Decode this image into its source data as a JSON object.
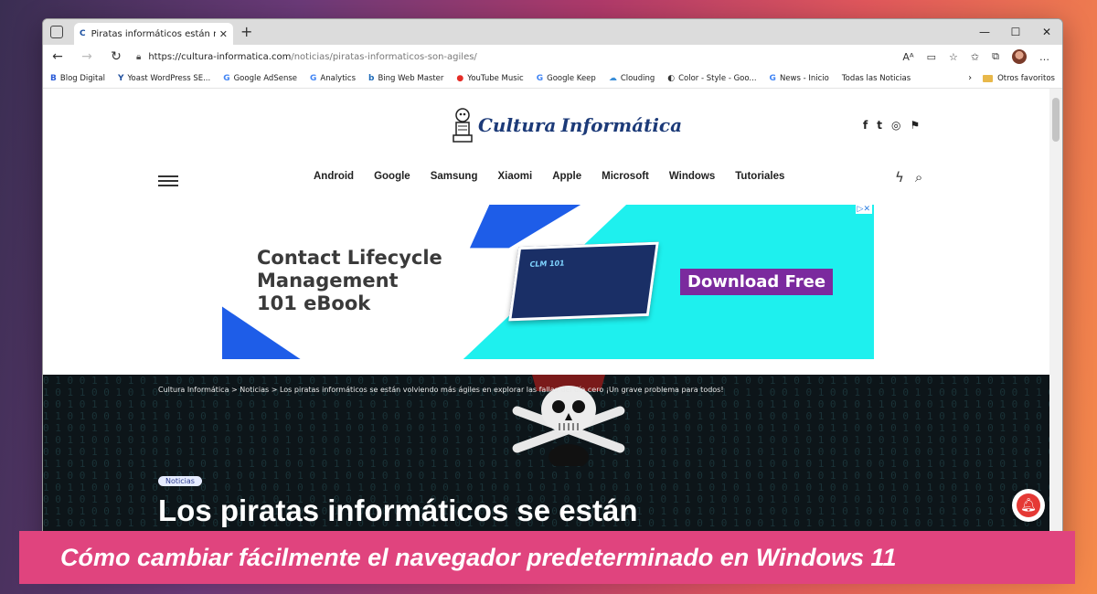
{
  "browser": {
    "tab_title": "Piratas informáticos están más á",
    "tab_favicon": "C",
    "tab_close": "✕",
    "new_tab": "+",
    "window_controls": [
      "—",
      "☐",
      "✕"
    ],
    "url_host": "https://cultura-informatica.com",
    "url_path": "/noticias/piratas-informaticos-son-agiles/",
    "bookmarks": [
      {
        "icon": "B",
        "label": "Blog Digital"
      },
      {
        "icon": "Y",
        "label": "Yoast WordPress SE..."
      },
      {
        "icon": "G",
        "label": "Google AdSense"
      },
      {
        "icon": "G",
        "label": "Analytics"
      },
      {
        "icon": "b",
        "label": "Bing Web Master"
      },
      {
        "icon": "●",
        "label": "YouTube Music"
      },
      {
        "icon": "G",
        "label": "Google Keep"
      },
      {
        "icon": "☁",
        "label": "Clouding"
      },
      {
        "icon": "◐",
        "label": "Color - Style - Goo..."
      },
      {
        "icon": "G",
        "label": "News - Inicio"
      },
      {
        "icon": "",
        "label": "Todas las Noticias"
      }
    ],
    "other_favorites": "Otros favoritos"
  },
  "site": {
    "logo_word1": "Cultura",
    "logo_word2": "Informática",
    "social": [
      "f",
      "t",
      "◎",
      "⚑"
    ],
    "menu": [
      "Android",
      "Google",
      "Samsung",
      "Xiaomi",
      "Apple",
      "Microsoft",
      "Windows",
      "Tutoriales"
    ]
  },
  "ad": {
    "headline_1": "Contact Lifecycle",
    "headline_2": "Management",
    "headline_3": "101 eBook",
    "book_title": "CLM 101",
    "cta": "Download Free",
    "ad_choice": "▷✕"
  },
  "article": {
    "breadcrumb": "Cultura Informática > Noticias > Los piratas informáticos se están volviendo más ágiles en explorar las fallas del día cero ¡Un grave problema para todos!",
    "category": "Noticias",
    "title": "Los piratas informáticos se están"
  },
  "caption": "Cómo cambiar fácilmente el navegador predeterminado en Windows 11"
}
